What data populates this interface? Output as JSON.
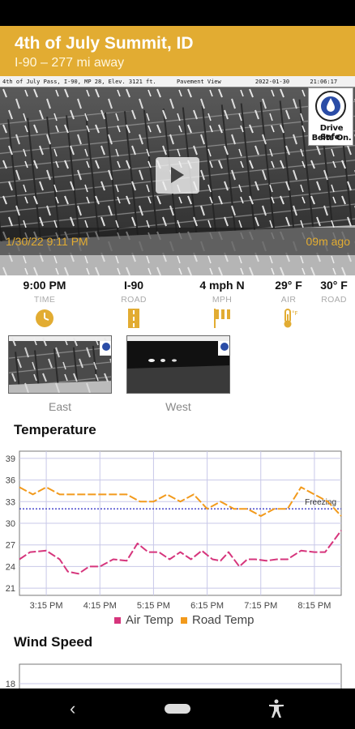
{
  "header": {
    "title": "4th of July Summit, ID",
    "subtitle": "I-90 – 277 mi away"
  },
  "camera": {
    "strip": {
      "location": "4th of July Pass, I-90, MP 28, Elev. 3121 ft.",
      "view": "Pavement View",
      "date": "2022-01-30",
      "time": "21:06:17"
    },
    "badge": {
      "line1": "Drive Safe.",
      "line2": "Belts On."
    },
    "play_icon": "play-icon",
    "timestamp": "1/30/22 9:11 PM",
    "age": "09m ago"
  },
  "stats": [
    {
      "value": "9:00 PM",
      "label": "TIME",
      "icon": "clock-icon"
    },
    {
      "value": "I-90",
      "label": "ROAD",
      "icon": "road-icon"
    },
    {
      "value": "4 mph N",
      "label": "MPH",
      "icon": "wind-icon"
    },
    {
      "value": "29° F",
      "label": "AIR",
      "icon": "thermometer-icon"
    },
    {
      "value": "30° F",
      "label": "ROAD",
      "icon": ""
    }
  ],
  "thumbnails": [
    {
      "label": "East"
    },
    {
      "label": "West"
    }
  ],
  "temperature_section": {
    "title": "Temperature"
  },
  "wind_section": {
    "title": "Wind Speed"
  },
  "colors": {
    "accent": "#e2ac32",
    "air_temp": "#d6357c",
    "road_temp": "#f29a1c",
    "freezing": "#3a3ac8"
  },
  "chart_data": [
    {
      "type": "line",
      "title": "Temperature",
      "x_ticks": [
        "3:15 PM",
        "4:15 PM",
        "5:15 PM",
        "6:15 PM",
        "7:15 PM",
        "8:15 PM"
      ],
      "y_ticks": [
        21,
        24,
        27,
        30,
        33,
        36,
        39
      ],
      "ylim": [
        20,
        40
      ],
      "xlim_hours": [
        15.0,
        21.0
      ],
      "grid": true,
      "legend_position": "bottom",
      "reference_line": {
        "label": "Freezing",
        "value": 32
      },
      "series": [
        {
          "name": "Air Temp",
          "color": "#d6357c",
          "x": [
            15.0,
            15.2,
            15.5,
            15.75,
            15.9,
            16.1,
            16.3,
            16.5,
            16.75,
            17.0,
            17.2,
            17.4,
            17.6,
            17.8,
            18.0,
            18.2,
            18.4,
            18.6,
            18.75,
            18.9,
            19.1,
            19.25,
            19.4,
            19.6,
            19.8,
            20.0,
            20.25,
            20.5,
            20.7,
            20.85,
            21.0
          ],
          "values": [
            25,
            26,
            26.2,
            25,
            23.3,
            23,
            24,
            24,
            25,
            24.8,
            27.2,
            26,
            26,
            25,
            26,
            25,
            26.2,
            25,
            24.8,
            26,
            24,
            25,
            25,
            24.8,
            25,
            25,
            26.2,
            26,
            26,
            27.5,
            29
          ]
        },
        {
          "name": "Road Temp",
          "color": "#f29a1c",
          "x": [
            15.0,
            15.25,
            15.5,
            15.75,
            16.0,
            16.5,
            17.0,
            17.25,
            17.5,
            17.75,
            18.0,
            18.25,
            18.5,
            18.75,
            19.0,
            19.25,
            19.5,
            19.75,
            20.0,
            20.25,
            20.5,
            20.75,
            21.0
          ],
          "values": [
            35,
            34,
            35,
            34,
            34,
            34,
            34,
            33,
            33,
            34,
            33,
            34,
            32,
            33,
            32,
            32,
            31,
            32,
            32,
            35,
            34,
            33,
            31
          ]
        }
      ]
    },
    {
      "type": "line",
      "title": "Wind Speed",
      "y_ticks": [
        18
      ],
      "grid": true,
      "series": []
    }
  ]
}
